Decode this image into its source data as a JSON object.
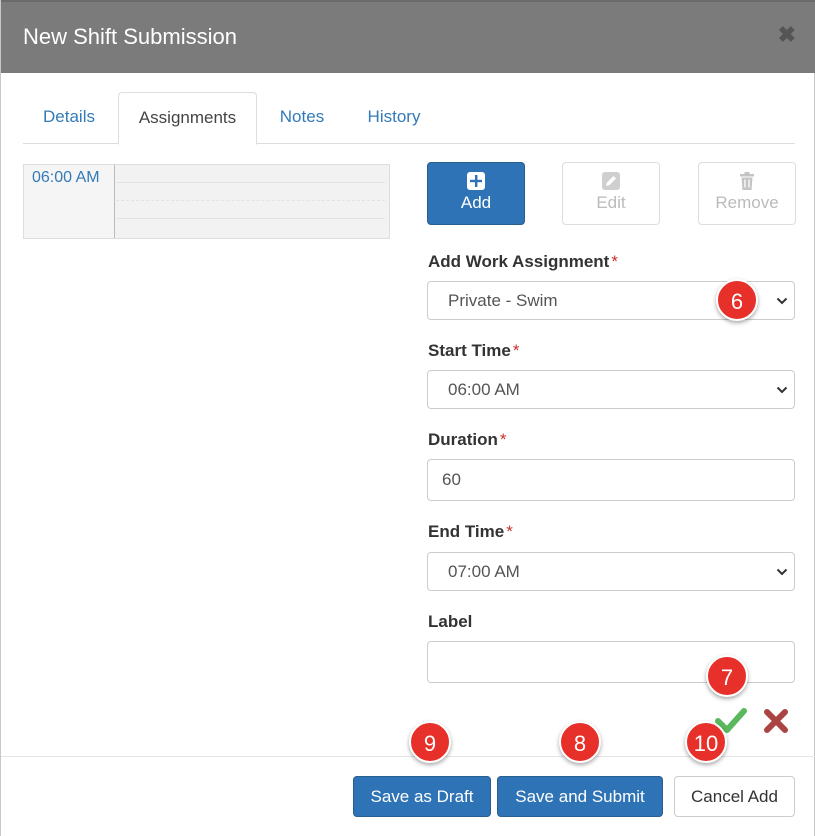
{
  "dialog": {
    "title": "New Shift Submission"
  },
  "tabs": [
    {
      "label": "Details"
    },
    {
      "label": "Assignments"
    },
    {
      "label": "Notes"
    },
    {
      "label": "History"
    }
  ],
  "calendar": {
    "time_label": "06:00 AM"
  },
  "toolbar": {
    "add_label": "Add",
    "edit_label": "Edit",
    "remove_label": "Remove"
  },
  "form": {
    "work_assignment": {
      "label": "Add Work Assignment",
      "value": "Private - Swim"
    },
    "start_time": {
      "label": "Start Time",
      "value": "06:00 AM"
    },
    "duration": {
      "label": "Duration",
      "value": "60"
    },
    "end_time": {
      "label": "End Time",
      "value": "07:00 AM"
    },
    "label_field": {
      "label": "Label",
      "value": ""
    },
    "required_mark": "*"
  },
  "callouts": {
    "c6": "6",
    "c7": "7",
    "c8": "8",
    "c9": "9",
    "c10": "10"
  },
  "footer": {
    "save_draft_label": "Save as Draft",
    "save_submit_label": "Save and Submit",
    "cancel_add_label": "Cancel Add"
  },
  "colors": {
    "header_bg": "#7b7b7b",
    "primary": "#2e73b5",
    "link": "#337ab7",
    "required": "#c9302c",
    "callout": "#e8302a",
    "confirm": "#5cb85c",
    "cancel": "#a94442"
  }
}
